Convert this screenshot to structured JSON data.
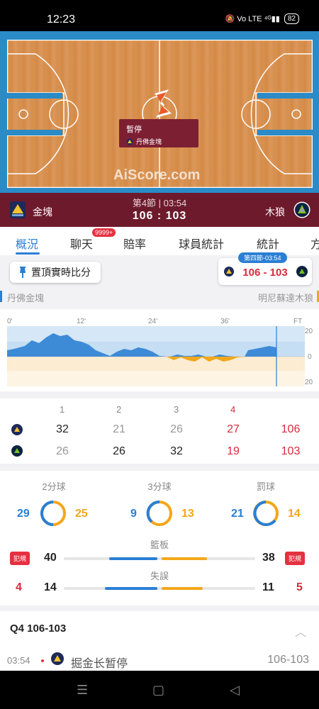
{
  "status": {
    "time": "12:23",
    "icons": "🔕 Vo LTE ⁴ᴳ▮▮",
    "battery": "82"
  },
  "court": {
    "pause_title": "暫停",
    "pause_team": "丹佛金塊",
    "watermark": "AiScore.com"
  },
  "scorebar": {
    "home_name": "金塊",
    "away_name": "木狼",
    "period": "第4節 | 03:54",
    "score": "106  :  103"
  },
  "tabs": [
    {
      "label": "概況"
    },
    {
      "label": "聊天"
    },
    {
      "label": "賠率"
    },
    {
      "label": "球員統計"
    },
    {
      "label": "統計"
    },
    {
      "label": "方"
    }
  ],
  "tab_badge": "9999+",
  "pin_button": "置頂實時比分",
  "live_card": {
    "tag": "第四節-03:54",
    "score": "106 - 103"
  },
  "teams": {
    "home_full": "丹佛金塊",
    "away_full": "明尼蘇達木狼"
  },
  "trend": {
    "x_ticks": [
      "0'",
      "12'",
      "24'",
      "36'",
      "FT"
    ],
    "y_ticks": [
      "20",
      "0",
      "20"
    ]
  },
  "quarters": {
    "headers": [
      "1",
      "2",
      "3",
      "4"
    ],
    "home": [
      "32",
      "21",
      "26",
      "27",
      "106"
    ],
    "away": [
      "26",
      "26",
      "32",
      "19",
      "103"
    ]
  },
  "stats": {
    "two_pt": {
      "label": "2分球",
      "home": "29",
      "away": "25"
    },
    "three_pt": {
      "label": "3分球",
      "home": "9",
      "away": "13"
    },
    "ft": {
      "label": "罰球",
      "home": "21",
      "away": "14"
    },
    "foul_label": "犯規",
    "rebounds": {
      "label": "籃板",
      "home": "40",
      "away": "38"
    },
    "turnovers": {
      "label": "失誤",
      "home": "14",
      "away": "11",
      "home_fouls": "4",
      "away_fouls": "5"
    }
  },
  "q4": {
    "title": "Q4   106-103",
    "event_time": "03:54",
    "event_text": "掘金长暂停",
    "event_score": "106-103"
  },
  "colors": {
    "home": "#2a7fd4",
    "away": "#f2a71b",
    "maroon": "#6d1a2c",
    "red": "#e53040"
  }
}
